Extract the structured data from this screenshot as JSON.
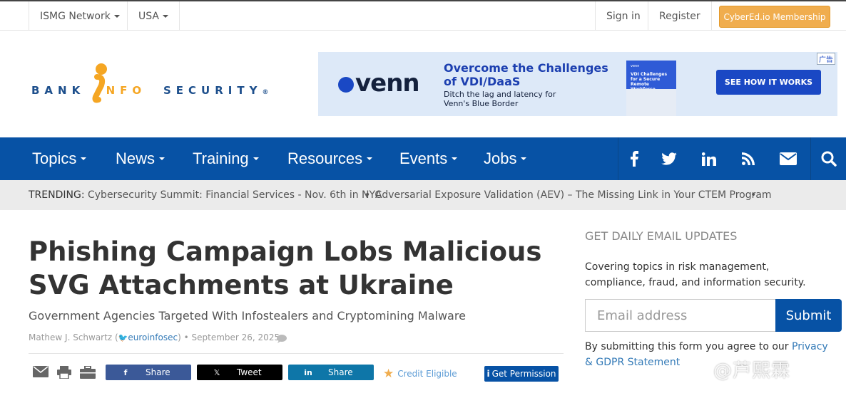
{
  "topbar": {
    "network_label": "ISMG Network",
    "region_label": "USA",
    "signin_label": "Sign in",
    "register_label": "Register",
    "membership_label": "CyberEd.io Membership"
  },
  "logo": {
    "word1": "BANK",
    "word2": "INFO",
    "word3": "SECURITY",
    "registered": "®"
  },
  "ad": {
    "brand": "venn",
    "headline": "Overcome the Challenges of VDI/DaaS",
    "subtext": "Ditch the lag and latency for Venn's Blue Border",
    "book_title": "VDI Challenges for a Secure Remote Workforce",
    "book_brand": "venn",
    "cta": "SEE HOW IT WORKS",
    "ad_tag": "广告"
  },
  "nav": {
    "items": [
      {
        "label": "Topics"
      },
      {
        "label": "News"
      },
      {
        "label": "Training"
      },
      {
        "label": "Resources"
      },
      {
        "label": "Events"
      },
      {
        "label": "Jobs"
      }
    ],
    "social_icons": [
      "facebook-icon",
      "twitter-icon",
      "linkedin-icon",
      "rss-icon",
      "mail-icon",
      "search-icon"
    ]
  },
  "trending": {
    "label": "TRENDING:",
    "items": [
      "Cybersecurity Summit: Financial Services - Nov. 6th in NYC",
      "Adversarial Exposure Validation (AEV) – The Missing Link in Your CTEM Program"
    ],
    "separator": "•"
  },
  "article": {
    "title": "Phishing Campaign Lobs Malicious SVG Attachments at Ukraine",
    "subtitle": "Government Agencies Targeted With Infostealers and Cryptomining Malware",
    "author": "Mathew J. Schwartz",
    "handle": "euroinfosec",
    "open_paren": "(",
    "close_paren": ")",
    "date": "• September 26, 2025"
  },
  "share": {
    "facebook_label": "Share",
    "x_label": "Tweet",
    "linkedin_label": "Share",
    "credit_label": "Credit Eligible",
    "permission_label": "Get Permission",
    "colors": {
      "facebook": "#3b5998",
      "x": "#000000",
      "linkedin": "#0e76a8",
      "credit_star": "#f0ad4e"
    }
  },
  "sidebar": {
    "heading": "GET DAILY EMAIL UPDATES",
    "description": "Covering topics in risk management, compliance, fraud, and information security.",
    "email_placeholder": "Email address",
    "submit_label": "Submit",
    "consent_text": "By submitting this form you agree to our ",
    "consent_link": "Privacy & GDPR Statement"
  },
  "watermark": "@芦熙霖",
  "colors": {
    "nav_blue": "#0752a5",
    "accent_orange": "#f0ad4e",
    "link_blue": "#337ab7"
  }
}
